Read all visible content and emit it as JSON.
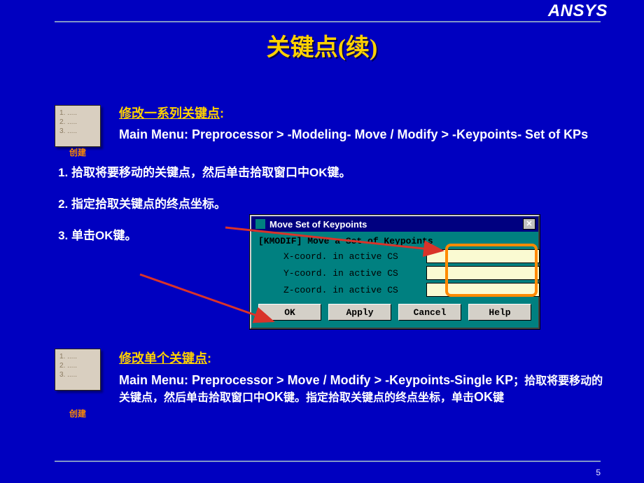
{
  "brand": "ANSYS",
  "page_number": "5",
  "title": "关键点(续)",
  "note_lines": [
    "1. .....",
    "2. .....",
    "3. ....."
  ],
  "note_caption": "创建",
  "section1": {
    "heading": "修改一系列关键点",
    "heading_colon": ":",
    "menu_path": "Main Menu:  Preprocessor > -Modeling- Move / Modify > -Keypoints- Set of KPs"
  },
  "steps": [
    "拾取将要移动的关键点，然后单击拾取窗口中OK键。",
    "指定拾取关键点的终点坐标。",
    "单击OK键。"
  ],
  "dialog": {
    "title": "Move Set of Keypoints",
    "header": "[KMODIF]  Move a Set of Keypoints",
    "rows": [
      "X-coord. in active CS",
      "Y-coord. in active CS",
      "Z-coord. in active CS"
    ],
    "buttons": {
      "ok": "OK",
      "apply": "Apply",
      "cancel": "Cancel",
      "help": "Help"
    },
    "close_glyph": "✕"
  },
  "section2": {
    "heading": "修改单个关键点",
    "heading_colon": ":",
    "menu_path": "Main Menu:  Preprocessor > Move / Modify > -Keypoints-Single KP",
    "sep": "；",
    "body_a": "拾取将要移动的关键点，然后单击拾取窗口中",
    "ok1": "OK",
    "body_b": "键。指定拾取关键点的终点坐标，单击",
    "ok2": "OK",
    "body_c": "键"
  }
}
